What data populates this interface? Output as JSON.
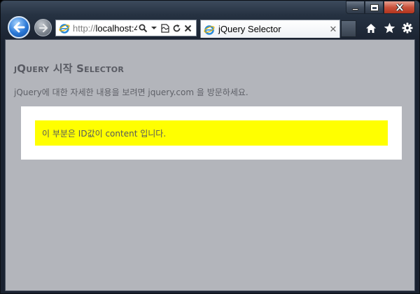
{
  "browser": {
    "address": {
      "protocol": "http://",
      "host": "localhost:4"
    },
    "tab": {
      "title": "jQuery Selector",
      "close_label": "✕"
    },
    "colors": {
      "viewport_bg": "#b3b5bb",
      "highlight": "#ffff00",
      "close_button": "#c9523c"
    }
  },
  "page": {
    "title": "jQuery 시작 Selector",
    "description": "jQuery에 대한 자세한 내용을 보려면 jquery.com 을 방문하세요.",
    "content_text": "이 부분은 ID값이 content 입니다."
  }
}
